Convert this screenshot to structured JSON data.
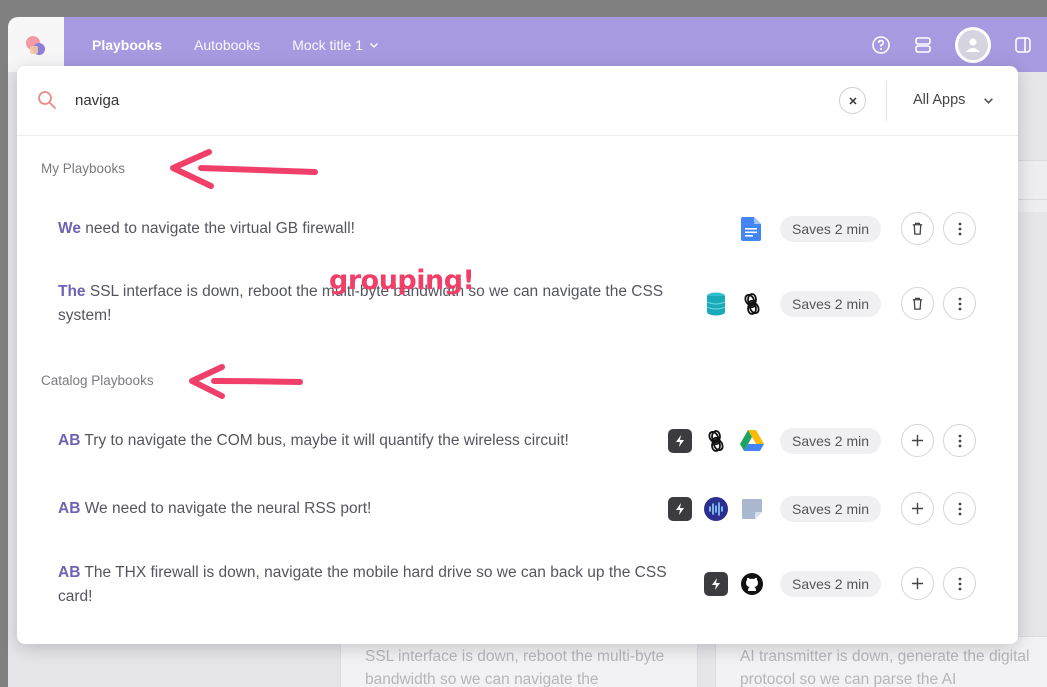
{
  "topbar": {
    "nav": [
      {
        "label": "Playbooks"
      },
      {
        "label": "Autobooks"
      },
      {
        "label": "Mock title 1"
      }
    ]
  },
  "background_cards": [
    {
      "text": "SSL interface is down, reboot the multi-byte bandwidth so we can navigate the"
    },
    {
      "text": "AI transmitter is down, generate the digital protocol so we can parse the AI"
    }
  ],
  "search": {
    "value": "naviga",
    "placeholder": "",
    "filter_label": "All Apps"
  },
  "sections": [
    {
      "title": "My Playbooks",
      "items": [
        {
          "prefix": "We",
          "text": " need to navigate the virtual GB firewall!",
          "apps": [
            "google-docs-icon"
          ],
          "saves": "Saves 2 min",
          "action": "delete"
        },
        {
          "prefix": "The",
          "text": " SSL interface is down, reboot the multi-byte bandwidth so we can navigate the CSS system!",
          "apps": [
            "database-icon",
            "openai-icon"
          ],
          "saves": "Saves 2 min",
          "action": "delete"
        }
      ]
    },
    {
      "title": "Catalog Playbooks",
      "items": [
        {
          "prefix": "AB",
          "text": " Try to navigate the COM bus, maybe it will quantify the wireless circuit!",
          "apps": [
            "bolt-icon",
            "openai-icon",
            "google-drive-icon"
          ],
          "saves": "Saves 2 min",
          "action": "add"
        },
        {
          "prefix": "AB",
          "text": " We need to navigate the neural RSS port!",
          "apps": [
            "bolt-icon",
            "audio-wave-icon",
            "sticky-note-icon"
          ],
          "saves": "Saves 2 min",
          "action": "add"
        },
        {
          "prefix": "AB",
          "text": " The THX firewall is down, navigate the mobile hard drive so we can back up the CSS card!",
          "apps": [
            "bolt-icon",
            "github-icon"
          ],
          "saves": "Saves 2 min",
          "action": "add"
        }
      ]
    }
  ],
  "annotation": {
    "text": "grouping!",
    "color": "#f0406a"
  },
  "colors": {
    "topbar": "#a89ae0",
    "prefix": "#6c63b4"
  }
}
